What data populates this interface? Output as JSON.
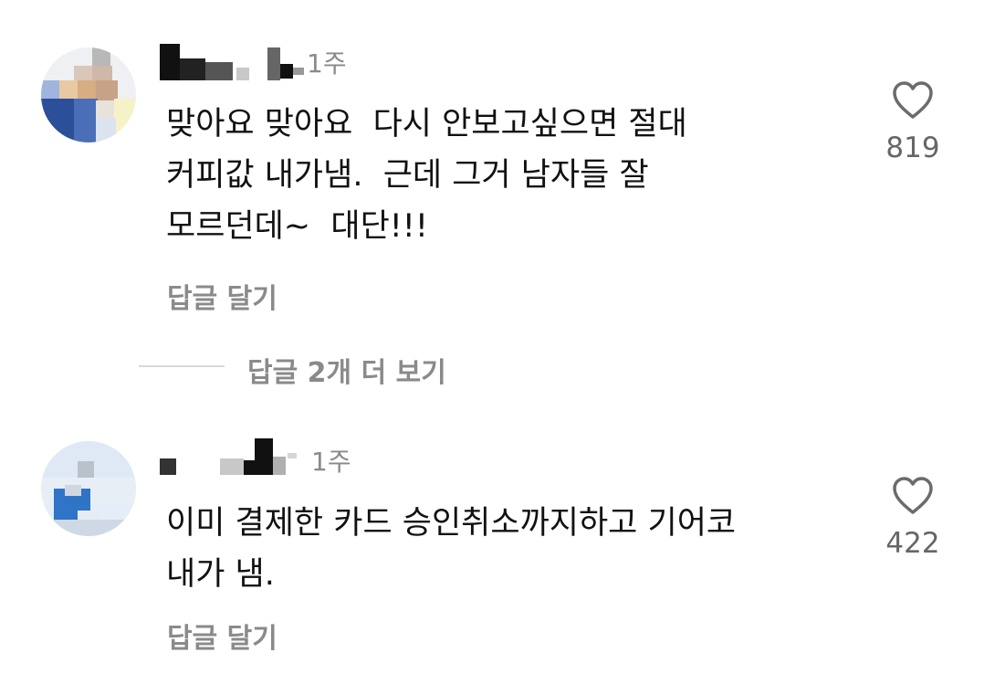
{
  "comments": [
    {
      "time": "1주",
      "text_lines": [
        "맞아요 맞아요  다시 안보고싶으면 절대",
        "커피값 내가냄.  근데 그거 남자들 잘",
        "모르던데~  대단!!!"
      ],
      "reply_label": "답글 달기",
      "like_count": "819"
    },
    {
      "time": "1주",
      "text_lines": [
        "이미 결제한 카드 승인취소까지하고 기어코",
        "내가 냄."
      ],
      "reply_label": "답글 달기",
      "like_count": "422"
    }
  ],
  "more_replies": {
    "label": "답글 2개 더 보기"
  },
  "colors": {
    "text": "#111111",
    "muted": "#8a8a8a",
    "like_count": "#666666",
    "heart_stroke": "#6b6b6b",
    "divider": "#d9d9d9"
  },
  "icons": {
    "like": "heart-outline-icon"
  }
}
